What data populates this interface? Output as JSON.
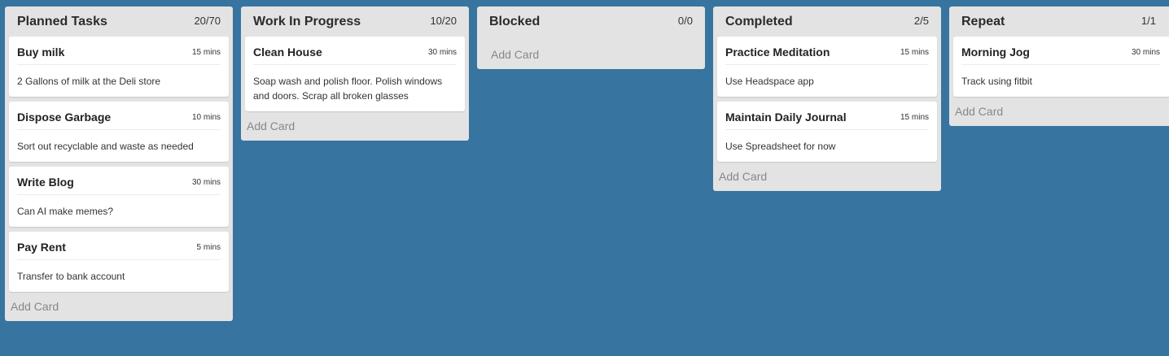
{
  "lanes": [
    {
      "title": "Planned Tasks",
      "count": "20/70",
      "add_card": "Add Card",
      "cards": [
        {
          "title": "Buy milk",
          "time": "15 mins",
          "desc": "2 Gallons of milk at the Deli store"
        },
        {
          "title": "Dispose Garbage",
          "time": "10 mins",
          "desc": "Sort out recyclable and waste as needed"
        },
        {
          "title": "Write Blog",
          "time": "30 mins",
          "desc": "Can AI make memes?"
        },
        {
          "title": "Pay Rent",
          "time": "5 mins",
          "desc": "Transfer to bank account"
        }
      ]
    },
    {
      "title": "Work In Progress",
      "count": "10/20",
      "add_card": "Add Card",
      "cards": [
        {
          "title": "Clean House",
          "time": "30 mins",
          "desc": "Soap wash and polish floor. Polish windows and doors. Scrap all broken glasses"
        }
      ]
    },
    {
      "title": "Blocked",
      "count": "0/0",
      "add_card": "Add Card",
      "cards": []
    },
    {
      "title": "Completed",
      "count": "2/5",
      "add_card": "Add Card",
      "cards": [
        {
          "title": "Practice Meditation",
          "time": "15 mins",
          "desc": "Use Headspace app"
        },
        {
          "title": "Maintain Daily Journal",
          "time": "15 mins",
          "desc": "Use Spreadsheet for now"
        }
      ]
    },
    {
      "title": "Repeat",
      "count": "1/1",
      "add_card": "Add Card",
      "cards": [
        {
          "title": "Morning Jog",
          "time": "30 mins",
          "desc": "Track using fitbit"
        }
      ]
    }
  ]
}
